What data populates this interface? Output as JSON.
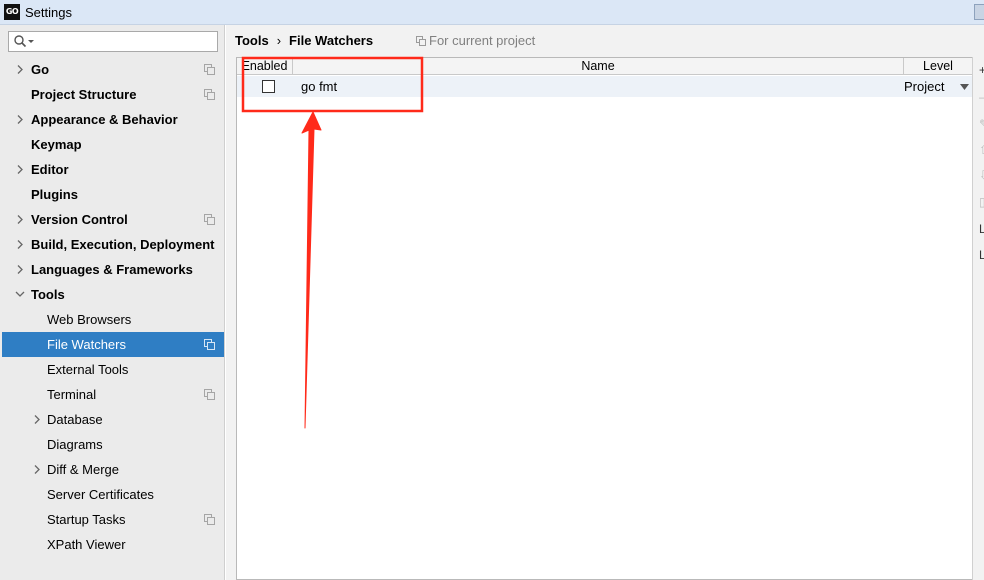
{
  "window": {
    "title": "Settings",
    "app_icon_text": "GO"
  },
  "sidebar": {
    "search_placeholder": "",
    "items": [
      {
        "label": "Go",
        "bold": true,
        "expander": "collapsed",
        "project_icon": true
      },
      {
        "label": "Project Structure",
        "bold": true,
        "expander": "none",
        "project_icon": true
      },
      {
        "label": "Appearance & Behavior",
        "bold": true,
        "expander": "collapsed",
        "project_icon": false
      },
      {
        "label": "Keymap",
        "bold": true,
        "expander": "none",
        "project_icon": false
      },
      {
        "label": "Editor",
        "bold": true,
        "expander": "collapsed",
        "project_icon": false
      },
      {
        "label": "Plugins",
        "bold": true,
        "expander": "none",
        "project_icon": false
      },
      {
        "label": "Version Control",
        "bold": true,
        "expander": "collapsed",
        "project_icon": true
      },
      {
        "label": "Build, Execution, Deployment",
        "bold": true,
        "expander": "collapsed",
        "project_icon": false
      },
      {
        "label": "Languages & Frameworks",
        "bold": true,
        "expander": "collapsed",
        "project_icon": false
      },
      {
        "label": "Tools",
        "bold": true,
        "expander": "expanded",
        "project_icon": false
      },
      {
        "label": "Web Browsers",
        "bold": false,
        "expander": "none",
        "project_icon": false,
        "child": true
      },
      {
        "label": "File Watchers",
        "bold": false,
        "expander": "none",
        "project_icon": true,
        "child": true,
        "selected": true
      },
      {
        "label": "External Tools",
        "bold": false,
        "expander": "none",
        "project_icon": false,
        "child": true
      },
      {
        "label": "Terminal",
        "bold": false,
        "expander": "none",
        "project_icon": true,
        "child": true
      },
      {
        "label": "Database",
        "bold": false,
        "expander": "collapsed",
        "project_icon": false,
        "child": true
      },
      {
        "label": "Diagrams",
        "bold": false,
        "expander": "none",
        "project_icon": false,
        "child": true
      },
      {
        "label": "Diff & Merge",
        "bold": false,
        "expander": "collapsed",
        "project_icon": false,
        "child": true
      },
      {
        "label": "Server Certificates",
        "bold": false,
        "expander": "none",
        "project_icon": false,
        "child": true
      },
      {
        "label": "Startup Tasks",
        "bold": false,
        "expander": "none",
        "project_icon": true,
        "child": true
      },
      {
        "label": "XPath Viewer",
        "bold": false,
        "expander": "none",
        "project_icon": false,
        "child": true
      }
    ]
  },
  "breadcrumb": {
    "parent": "Tools",
    "separator": "›",
    "current": "File Watchers"
  },
  "scope_note": "For current project",
  "table": {
    "columns": [
      "Enabled",
      "Name",
      "Level"
    ],
    "rows": [
      {
        "enabled": false,
        "name": "go fmt",
        "level": "Project"
      }
    ]
  },
  "right_strip": {
    "glyphs": [
      "+",
      "–",
      "✎",
      "⇧",
      "⇩",
      "▯",
      "L",
      "L"
    ]
  },
  "colors": {
    "selection": "#2f7ec4",
    "annotation": "#ff2a1a",
    "sidebar_bg": "#ebebeb"
  }
}
